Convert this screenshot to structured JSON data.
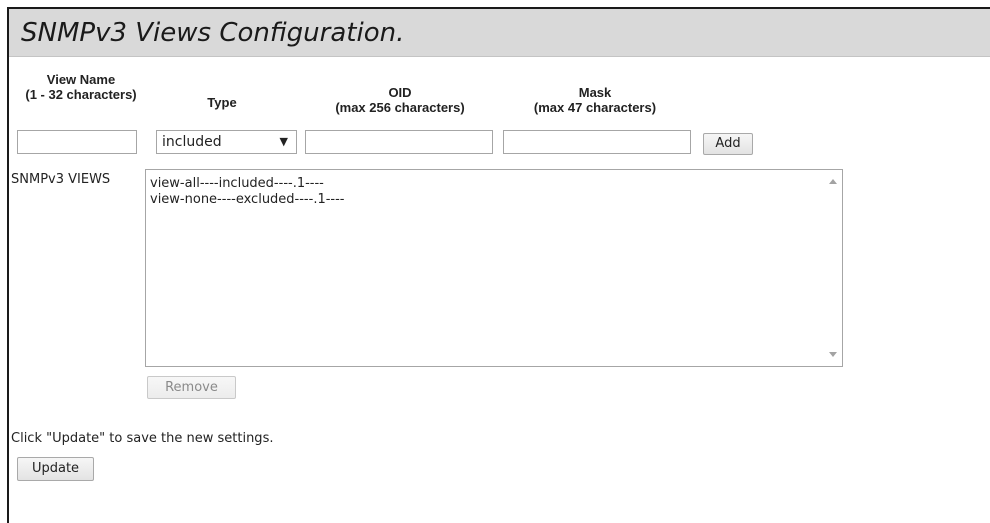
{
  "page": {
    "title": "SNMPv3 Views Configuration."
  },
  "form": {
    "headers": {
      "view_name": [
        "View Name",
        "(1 - 32 characters)"
      ],
      "type": [
        "Type"
      ],
      "oid": [
        "OID",
        "(max 256 characters)"
      ],
      "mask": [
        "Mask",
        "(max 47 characters)"
      ]
    },
    "view_name_value": "",
    "type_selected": "included",
    "oid_value": "",
    "mask_value": "",
    "add_label": "Add"
  },
  "views": {
    "label": "SNMPv3 VIEWS",
    "items": [
      "view-all----included----.1----",
      "view-none----excluded----.1----"
    ],
    "remove_label": "Remove"
  },
  "footer": {
    "hint": "Click \"Update\" to save the new settings.",
    "update_label": "Update"
  }
}
